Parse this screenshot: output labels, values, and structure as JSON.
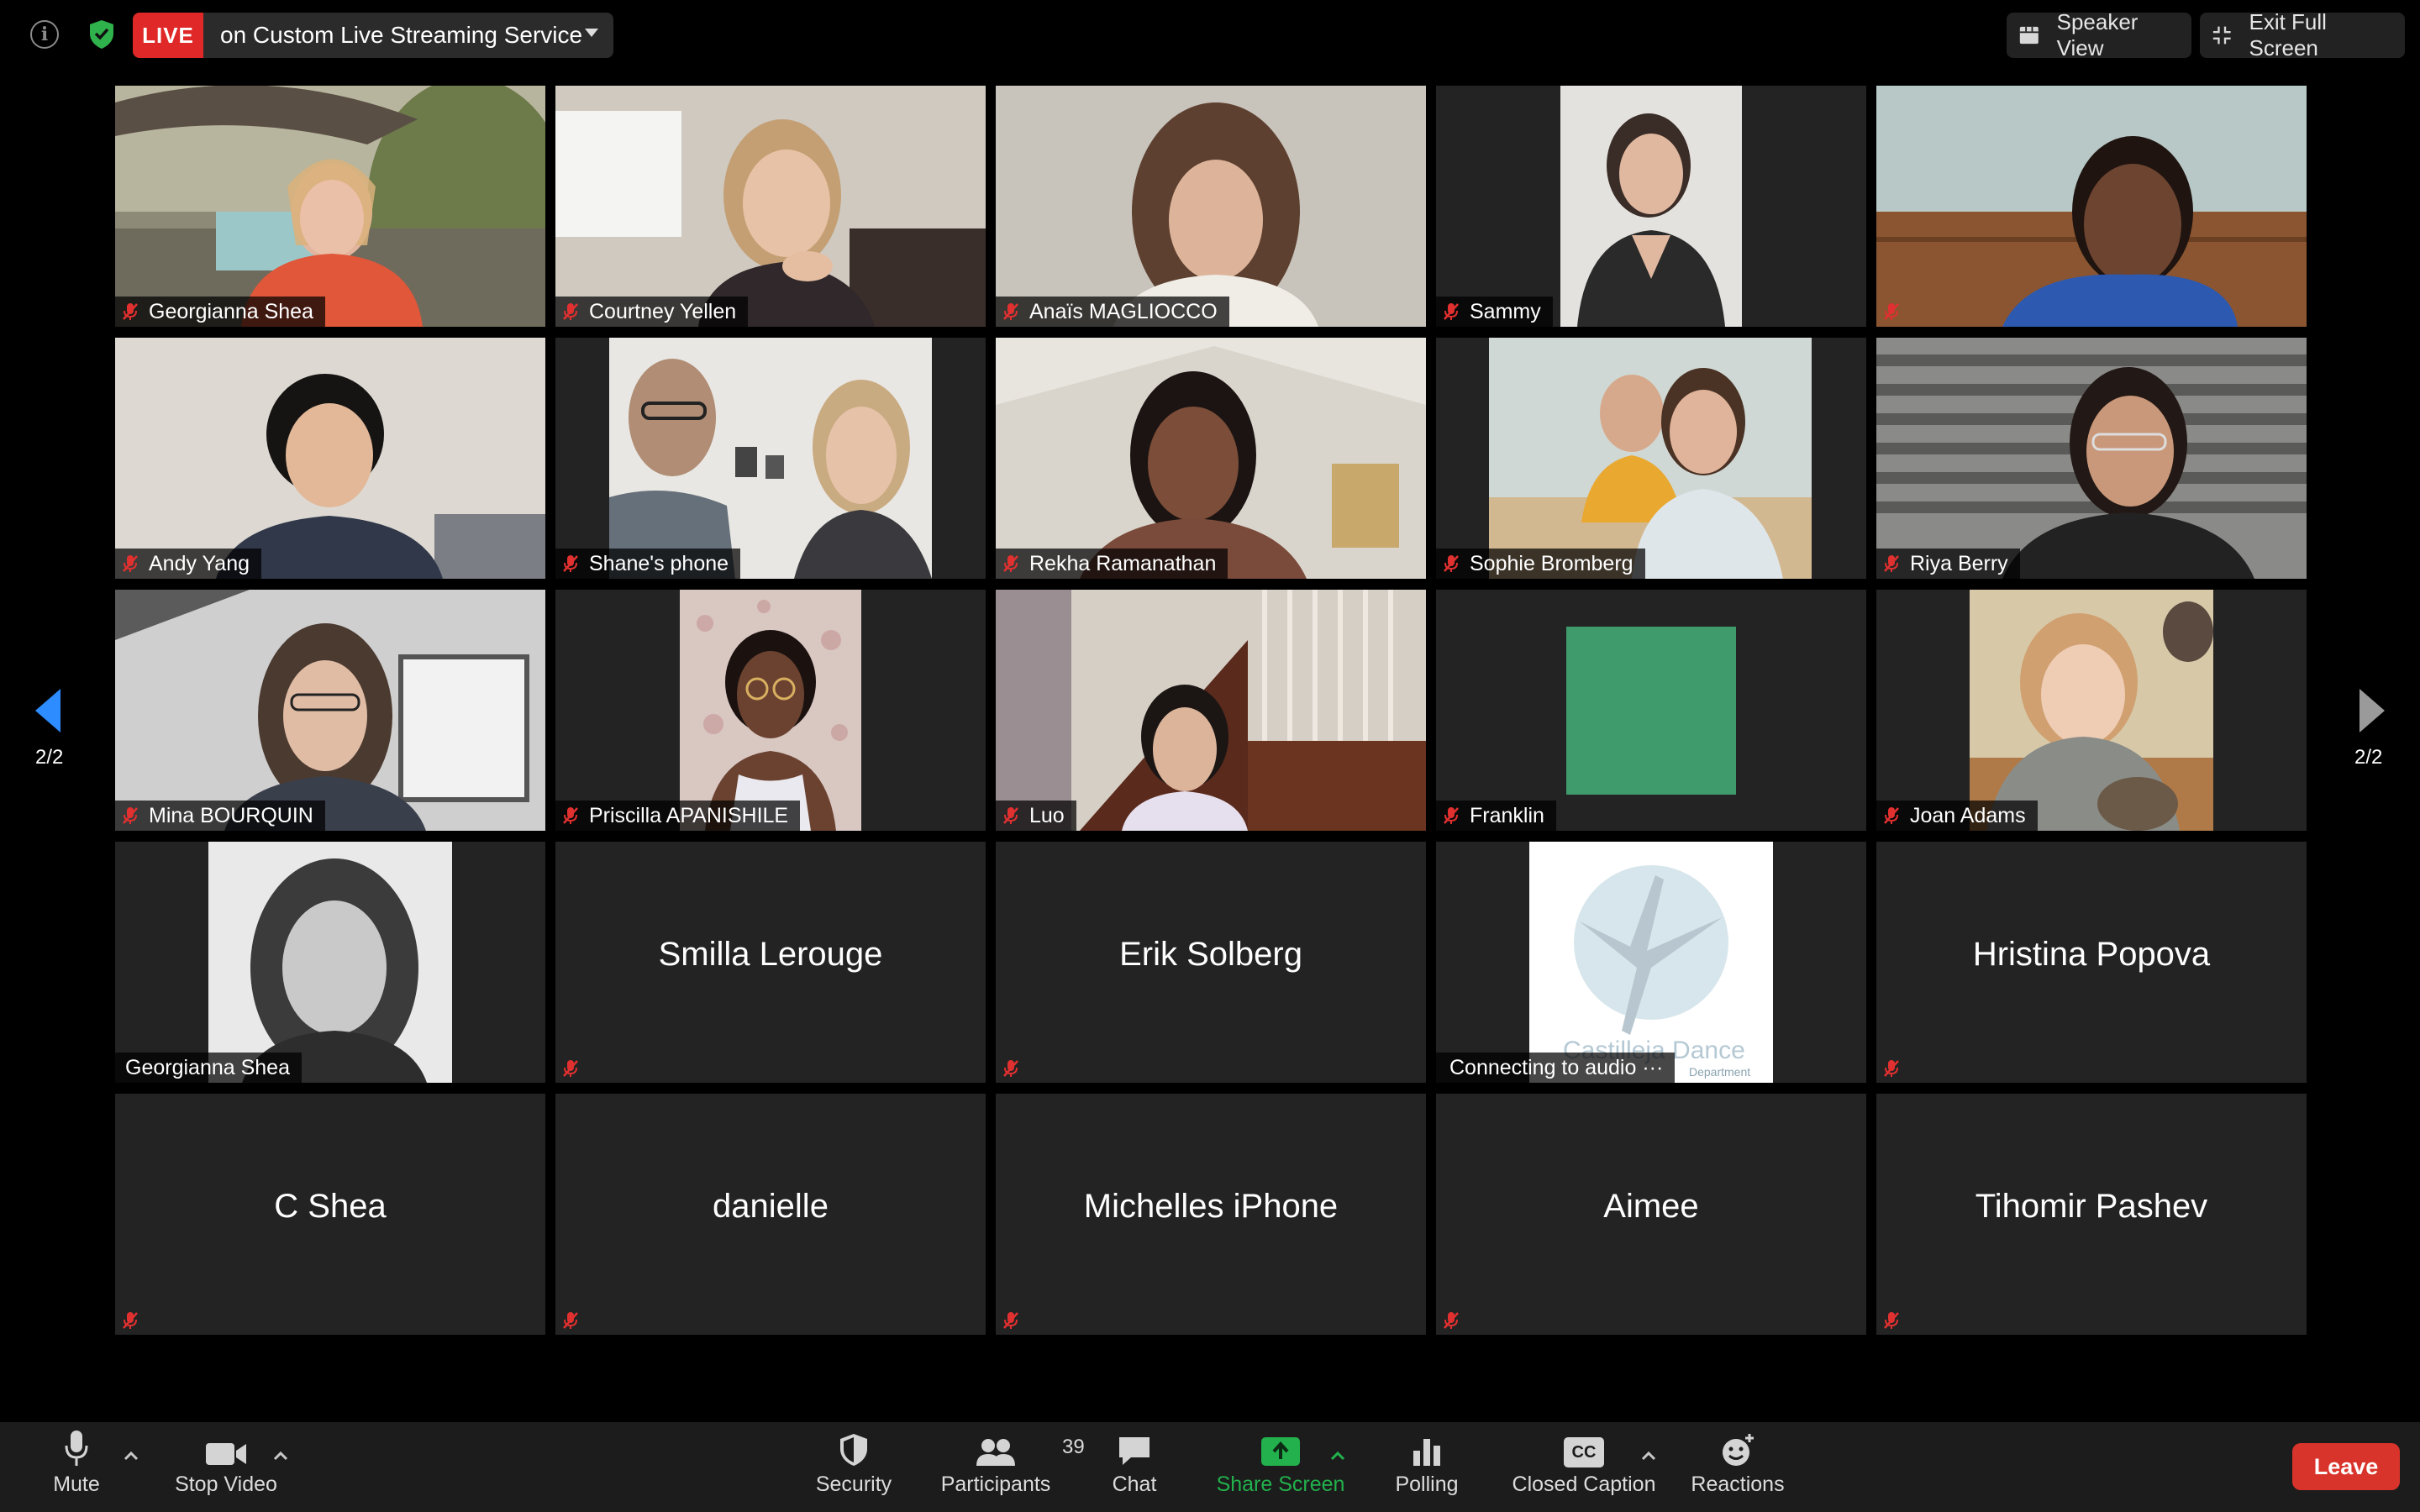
{
  "meeting": {
    "live_badge": "LIVE",
    "live_text": "on Custom Live Streaming Service",
    "speaker_view": "Speaker View",
    "exit_full_screen": "Exit Full Screen",
    "page_indicator": "2/2"
  },
  "participants": [
    {
      "name": "Georgianna Shea"
    },
    {
      "name": "Courtney Yellen"
    },
    {
      "name": "Anaïs MAGLIOCCO"
    },
    {
      "name": "Sammy"
    },
    {
      "name": ""
    },
    {
      "name": "Andy Yang"
    },
    {
      "name": "Shane's phone"
    },
    {
      "name": "Rekha Ramanathan"
    },
    {
      "name": "Sophie Bromberg"
    },
    {
      "name": "Riya Berry"
    },
    {
      "name": "Mina BOURQUIN"
    },
    {
      "name": "Priscilla APANISHILE"
    },
    {
      "name": "Luo"
    },
    {
      "name": "Franklin"
    },
    {
      "name": "Joan Adams"
    },
    {
      "name": "Georgianna Shea"
    },
    {
      "name": "Smilla Lerouge"
    },
    {
      "name": "Erik Solberg"
    },
    {
      "name": "Connecting to audio ···"
    },
    {
      "name": "Hristina Popova"
    },
    {
      "name": "C Shea"
    },
    {
      "name": "danielle"
    },
    {
      "name": "Michelles iPhone"
    },
    {
      "name": "Aimee"
    },
    {
      "name": "Tihomir Pashev"
    }
  ],
  "logo": {
    "text": "Castilleja Dance",
    "sub": "Department"
  },
  "toolbar": {
    "mute": "Mute",
    "stop_video": "Stop Video",
    "security": "Security",
    "participants": "Participants",
    "participants_count": "39",
    "chat": "Chat",
    "share_screen": "Share Screen",
    "polling": "Polling",
    "closed_caption": "Closed Caption",
    "cc_icon_text": "CC",
    "reactions": "Reactions",
    "leave": "Leave"
  },
  "colors": {
    "live_red": "#e02828",
    "leave_red": "#d9342b",
    "share_green": "#22b14c",
    "muted_red": "#e03030",
    "page_arrow_blue": "#2d8cff",
    "avatar_green": "#3f9a6c"
  }
}
